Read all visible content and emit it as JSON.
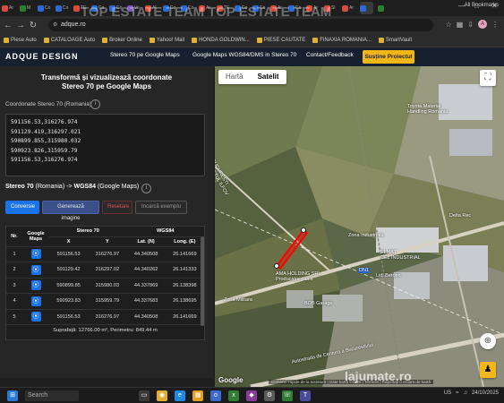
{
  "browser": {
    "tabs": [
      {
        "label": "Ar",
        "color": "#d94c3d"
      },
      {
        "label": "M",
        "color": "#2e7d32"
      },
      {
        "label": "Co",
        "color": "#2b6cd4"
      },
      {
        "label": "Co",
        "color": "#2b6cd4"
      },
      {
        "label": "TE",
        "color": "#d94c3d"
      },
      {
        "label": "Co",
        "color": "#2b6cd4"
      },
      {
        "label": "Co",
        "color": "#2b6cd4"
      },
      {
        "label": "Ve",
        "color": "#7a5cc4"
      },
      {
        "label": "Al",
        "color": "#d94c3d"
      },
      {
        "label": "Co",
        "color": "#2b6cd4"
      },
      {
        "label": "Co",
        "color": "#2b6cd4"
      },
      {
        "label": "Ar",
        "color": "#d94c3d"
      },
      {
        "label": "TE",
        "color": "#d94c3d"
      },
      {
        "label": "Co",
        "color": "#2b6cd4"
      },
      {
        "label": "Co",
        "color": "#2b6cd4"
      },
      {
        "label": "Ar",
        "color": "#d94c3d"
      },
      {
        "label": "Co",
        "color": "#2b6cd4"
      },
      {
        "label": "Ar",
        "color": "#d94c3d"
      },
      {
        "label": "Sl",
        "color": "#d94c3d"
      },
      {
        "label": "Ar",
        "color": "#d94c3d"
      },
      {
        "label": "",
        "color": "#2b6cd4"
      },
      {
        "label": "",
        "color": "#2e7d32"
      }
    ],
    "url": "adque.ro",
    "bookmarks": [
      "Piese Auto",
      "CATALOAGE Auto",
      "Broker Online",
      "Yahoo! Mail",
      "HONDA GOLDWIN...",
      "PIESE CAUTATE",
      "FINAXIA ROMANIA...",
      "SmartVault"
    ],
    "all_bookmarks": "All Bookmarks",
    "profile_initial": "A"
  },
  "site": {
    "logo": "ADQUE DESIGN",
    "nav": [
      "Stereo 70 pe Google Maps",
      "Google Maps WGS84/DMS in Stereo 70",
      "Contact/Feedback"
    ],
    "support": "Susține Proiectul"
  },
  "panel": {
    "title_line1": "Transformă și vizualizează coordonate",
    "title_line2": "Stereo 70 pe Google Maps",
    "coord_label": "Coordonate Stereo 70 (Romania)",
    "coords": [
      "591156.53,316276.974",
      "591129.419,316297.021",
      "590899.855,315980.032",
      "590923.826,315959.79",
      "591156.53,316276.974"
    ],
    "conv_from": "Stereo 70",
    "conv_from_suffix": "(Romania) ->",
    "conv_to": "WGS84",
    "conv_to_suffix": "(Google Maps)",
    "buttons": {
      "convert": "Conversie",
      "generate": "Generează imagine",
      "reset": "Resetare",
      "example": "Incarcă exemplu"
    },
    "table": {
      "h_nr": "Nr.",
      "h_maps": "Google Maps",
      "h_stereo": "Stereo 70",
      "h_wgs": "WGS84",
      "h_x": "X",
      "h_y": "Y",
      "h_lat": "Lat. (N)",
      "h_long": "Long. (E)",
      "rows": [
        {
          "nr": "1",
          "x": "591156.53",
          "y": "316276.97",
          "lat": "44.340508",
          "long": "26.141669"
        },
        {
          "nr": "2",
          "x": "591129.42",
          "y": "316297.02",
          "lat": "44.340262",
          "long": "26.141333"
        },
        {
          "nr": "3",
          "x": "590899.85",
          "y": "315980.03",
          "lat": "44.337869",
          "long": "26.138398"
        },
        {
          "nr": "4",
          "x": "590923.83",
          "y": "315959.79",
          "lat": "44.337683",
          "long": "26.138695"
        },
        {
          "nr": "5",
          "x": "591156.53",
          "y": "316276.97",
          "lat": "44.340508",
          "long": "26.141669"
        }
      ]
    },
    "summary": "Suprafață: 12766.00 m², Perimetru: 849.44 m"
  },
  "map": {
    "tab_map": "Hartă",
    "tab_sat": "Satelit",
    "labels": {
      "toyota": "Toyota Material\nHandling Romania",
      "bucuresti_ilfov": "BUCURESTI\nJUDETUL ILFOV",
      "zona_ind": "Zona Industriala",
      "ama": "AMA HOLDING SRL\nProducator paleti",
      "bob": "BOB Garage",
      "delta": "Delta Rec",
      "elmat": "ELMAT\nCEL INDUSTRIAL",
      "lidl": "Lidl Bercen",
      "centura": "Autostrada de Centura a Bucurestiului",
      "zona_mil": "Zona Militara",
      "dn": "DN1"
    },
    "google": "Google",
    "footer": "Comenzi rapide de la tastatură | Date hartă ©2025 | Termeni | Raportați o eroare de hartă"
  },
  "taskbar": {
    "search": "Search",
    "time": "24/10/2025",
    "lang": "US"
  },
  "watermark": {
    "top": "TOP ESTATE TEAM     TOP ESTATE TEAM",
    "bottom": "lajumate.ro"
  }
}
